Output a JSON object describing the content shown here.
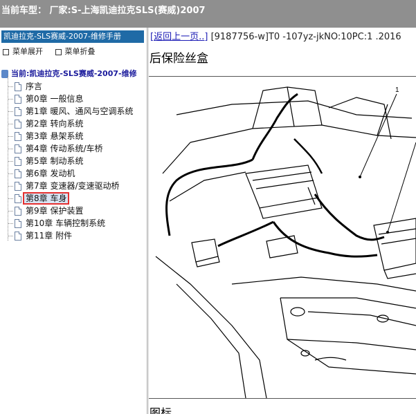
{
  "header": {
    "text": "当前车型：  厂家:S-上海凯迪拉克SLS(赛威)2007"
  },
  "sidebar": {
    "manual_title": "凯迪拉克-SLS赛威-2007-维修手册",
    "expand_label": "菜单展开",
    "collapse_label": "菜单折叠",
    "root_label": "当前:凯迪拉克-SLS赛威-2007-维修",
    "items": [
      {
        "label": "序言"
      },
      {
        "label": "第0章  一般信息"
      },
      {
        "label": "第1章  暖风、通风与空调系统"
      },
      {
        "label": "第2章  转向系统"
      },
      {
        "label": "第3章  悬架系统"
      },
      {
        "label": "第4章  传动系统/车桥"
      },
      {
        "label": "第5章  制动系统"
      },
      {
        "label": "第6章  发动机"
      },
      {
        "label": "第7章  变速器/变速驱动桥"
      },
      {
        "label": "第8章  车身",
        "selected": true
      },
      {
        "label": "第9章  保护装置"
      },
      {
        "label": "第10章  车辆控制系统"
      },
      {
        "label": "第11章  附件"
      }
    ]
  },
  "content": {
    "back_link": "[返回上一页..]",
    "doc_id": "[9187756-w]T0 -107yz-jkNO:10PC:1 .2016",
    "heading": "后保险丝盒",
    "callout": "1",
    "caption": "图标"
  },
  "colors": {
    "accent": "#1f6aa6",
    "selection_border": "#e53030",
    "topbar": "#8f8f8f",
    "link": "#1b1bb5"
  }
}
